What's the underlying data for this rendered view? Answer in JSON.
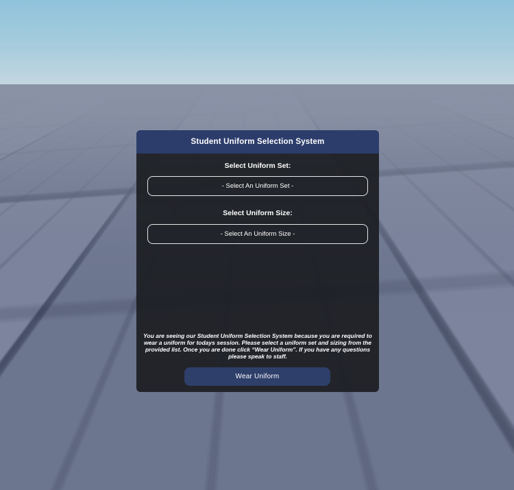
{
  "colors": {
    "header_bg": "#2c3d6c",
    "button_bg": "#2e3f6a",
    "panel_bg": "rgba(28,30,34,0.93)",
    "sky_top": "#8fc3dc",
    "sky_horizon": "#c4d7e0",
    "ground_base": "#737c97",
    "fog": "#8a92a6",
    "text": "#ffffff",
    "field_border": "#e9e9e9"
  },
  "dialog": {
    "title": "Student Uniform Selection System",
    "uniform_set": {
      "label": "Select Uniform Set:",
      "selected": "- Select An Uniform Set -"
    },
    "uniform_size": {
      "label": "Select Uniform Size:",
      "selected": "- Select An Uniform Size -"
    },
    "info_text": "You are seeing our Student Uniform Selection System because you are required to wear a uniform for todays session. Please select a uniform set and sizing from the provided list. Once you are done click “Wear Uniform”. If you have any questions please speak to staff.",
    "wear_button": "Wear Uniform"
  }
}
